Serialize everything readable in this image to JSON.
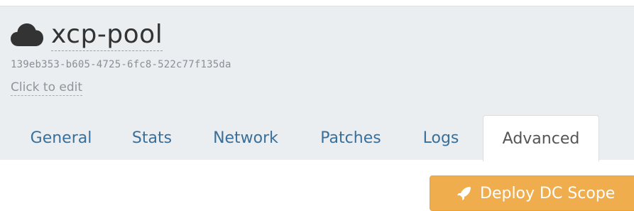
{
  "pool": {
    "name": "xcp-pool",
    "uuid": "139eb353-b605-4725-6fc8-522c77f135da",
    "description_placeholder": "Click to edit",
    "icon": "cloud-icon"
  },
  "tabs": [
    {
      "label": "General",
      "active": false
    },
    {
      "label": "Stats",
      "active": false
    },
    {
      "label": "Network",
      "active": false
    },
    {
      "label": "Patches",
      "active": false
    },
    {
      "label": "Logs",
      "active": false
    },
    {
      "label": "Advanced",
      "active": true
    }
  ],
  "actions": {
    "deploy_label": "Deploy DC Scope",
    "deploy_icon": "rocket-icon",
    "deploy_color": "#f0ad4e"
  },
  "colors": {
    "header_bg": "#ebeef0",
    "tab_link": "#3a6f99",
    "title": "#333333"
  }
}
